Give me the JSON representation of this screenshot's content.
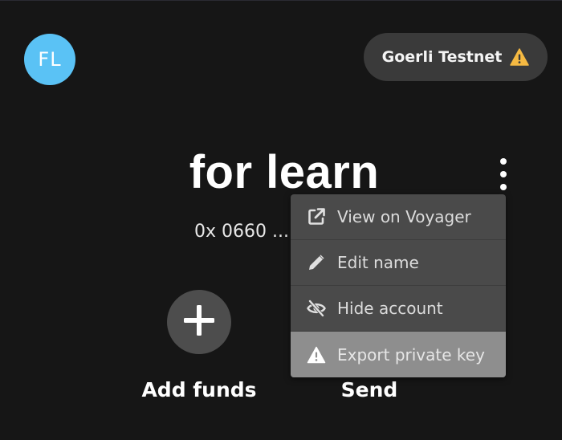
{
  "avatar": {
    "initials": "FL",
    "color": "#5ac2f5"
  },
  "network": {
    "label": "Goerli Testnet",
    "icon": "warning-icon",
    "icon_color": "#f5b942"
  },
  "account": {
    "name": "for learn",
    "address": "0x 0660 ..."
  },
  "actions": [
    {
      "label": "Add funds",
      "icon": "plus-icon"
    },
    {
      "label": "Send",
      "icon": "send-icon"
    }
  ],
  "menu": {
    "items": [
      {
        "label": "View on Voyager",
        "icon": "external-link-icon"
      },
      {
        "label": "Edit name",
        "icon": "pencil-icon"
      },
      {
        "label": "Hide account",
        "icon": "eye-slash-icon"
      },
      {
        "label": "Export private key",
        "icon": "warning-icon",
        "highlighted": true
      }
    ]
  }
}
